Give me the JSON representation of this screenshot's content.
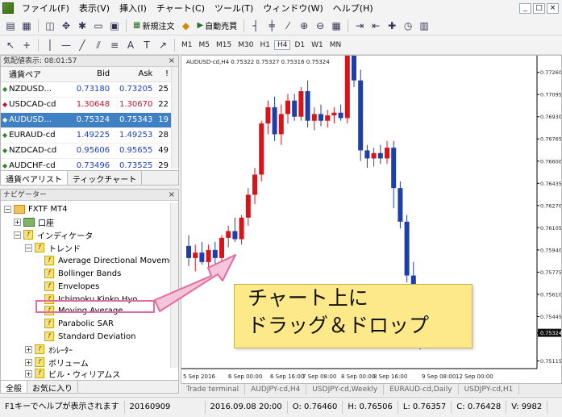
{
  "menubar": {
    "items": [
      "ファイル(F)",
      "表示(V)",
      "挿入(I)",
      "チャート(C)",
      "ツール(T)",
      "ウィンドウ(W)",
      "ヘルプ(H)"
    ],
    "window_buttons": [
      "_",
      "□",
      "×"
    ]
  },
  "toolbar": {
    "new_order_label": "新規注文",
    "auto_trade_label": "自動売買",
    "timeframes": [
      "M1",
      "M5",
      "M15",
      "M30",
      "H1",
      "H4",
      "D1",
      "W1",
      "MN"
    ],
    "active_timeframe": "H4"
  },
  "market_watch": {
    "title": "気配値表示: 08:01:57",
    "col_symbol": "通貨ペア",
    "col_bid": "Bid",
    "col_ask": "Ask",
    "col_extra": "!",
    "rows": [
      {
        "symbol": "NZDUSD...",
        "bid": "0.73180",
        "ask": "0.73205",
        "spread": "25",
        "dir": "up"
      },
      {
        "symbol": "USDCAD-cd",
        "bid": "1.30648",
        "ask": "1.30670",
        "spread": "22",
        "dir": "down"
      },
      {
        "symbol": "AUDUSD...",
        "bid": "0.75324",
        "ask": "0.75343",
        "spread": "19",
        "dir": "up"
      },
      {
        "symbol": "EURAUD-cd",
        "bid": "1.49225",
        "ask": "1.49253",
        "spread": "28",
        "dir": "up"
      },
      {
        "symbol": "NZDCAD-cd",
        "bid": "0.95606",
        "ask": "0.95655",
        "spread": "49",
        "dir": "up"
      },
      {
        "symbol": "AUDCHF-cd",
        "bid": "0.73496",
        "ask": "0.73525",
        "spread": "29",
        "dir": "up"
      }
    ],
    "tabs": [
      "通貨ペアリスト",
      "ティックチャート"
    ]
  },
  "navigator": {
    "title": "ナビゲーター",
    "root": "FXTF MT4",
    "accounts": "口座",
    "indicators": "インディケータ",
    "trend": "トレンド",
    "trend_items": [
      "Average Directional Moveme",
      "Bollinger Bands",
      "Envelopes",
      "Ichimoku Kinko Hyo",
      "Moving Average",
      "Parabolic SAR",
      "Standard Deviation"
    ],
    "oscillators": "ｵｼﾚｰﾀｰ",
    "volumes": "ボリューム",
    "bill_williams": "ビル・ウィリアムス",
    "tabs": [
      "全般",
      "お気に入り"
    ]
  },
  "chart": {
    "header": "AUDUSD-cd,H4  0.75322 0.75327 0.75316 0.75324",
    "ticks": [
      "0.77260",
      "0.77095",
      "0.76930",
      "0.76765",
      "0.76600",
      "0.76435",
      "0.76270",
      "0.76105",
      "0.75940",
      "0.75775",
      "0.75610",
      "0.75445",
      "0.75324",
      "0.75115"
    ],
    "price_tag": "0.75324",
    "x_labels": [
      "5 Sep 2016",
      "6 Sep 00:00",
      "6 Sep 16:00",
      "7 Sep 08:00",
      "8 Sep 00:00",
      "8 Sep 16:00",
      "9 Sep 08:00",
      "12 Sep 00:00"
    ]
  },
  "chart_data": {
    "type": "candlestick",
    "title": "AUDUSD-cd,H4",
    "ylim": [
      0.7507,
      0.773
    ],
    "colors": {
      "up": "#d8141b",
      "down": "#1f3fa8"
    },
    "candles": [
      {
        "o": 0.7597,
        "h": 0.7605,
        "l": 0.7582,
        "c": 0.7588
      },
      {
        "o": 0.7588,
        "h": 0.7598,
        "l": 0.7578,
        "c": 0.7592
      },
      {
        "o": 0.7592,
        "h": 0.76,
        "l": 0.7583,
        "c": 0.7585
      },
      {
        "o": 0.7585,
        "h": 0.7598,
        "l": 0.758,
        "c": 0.7594
      },
      {
        "o": 0.7594,
        "h": 0.76,
        "l": 0.7583,
        "c": 0.7588
      },
      {
        "o": 0.7588,
        "h": 0.7605,
        "l": 0.7585,
        "c": 0.7603
      },
      {
        "o": 0.7603,
        "h": 0.7612,
        "l": 0.7596,
        "c": 0.7608
      },
      {
        "o": 0.7608,
        "h": 0.7618,
        "l": 0.76,
        "c": 0.7602
      },
      {
        "o": 0.7602,
        "h": 0.762,
        "l": 0.7598,
        "c": 0.7618
      },
      {
        "o": 0.7618,
        "h": 0.764,
        "l": 0.7612,
        "c": 0.7635
      },
      {
        "o": 0.7635,
        "h": 0.7655,
        "l": 0.7628,
        "c": 0.765
      },
      {
        "o": 0.765,
        "h": 0.769,
        "l": 0.7645,
        "c": 0.7688
      },
      {
        "o": 0.7688,
        "h": 0.7705,
        "l": 0.768,
        "c": 0.77
      },
      {
        "o": 0.77,
        "h": 0.7708,
        "l": 0.7675,
        "c": 0.768
      },
      {
        "o": 0.768,
        "h": 0.7702,
        "l": 0.7672,
        "c": 0.7695
      },
      {
        "o": 0.7695,
        "h": 0.771,
        "l": 0.7688,
        "c": 0.7705
      },
      {
        "o": 0.7705,
        "h": 0.771,
        "l": 0.769,
        "c": 0.7693
      },
      {
        "o": 0.7693,
        "h": 0.7715,
        "l": 0.769,
        "c": 0.7712
      },
      {
        "o": 0.7712,
        "h": 0.772,
        "l": 0.7685,
        "c": 0.769
      },
      {
        "o": 0.769,
        "h": 0.77,
        "l": 0.7683,
        "c": 0.7695
      },
      {
        "o": 0.7695,
        "h": 0.7702,
        "l": 0.7686,
        "c": 0.769
      },
      {
        "o": 0.769,
        "h": 0.7698,
        "l": 0.7685,
        "c": 0.7694
      },
      {
        "o": 0.7694,
        "h": 0.77,
        "l": 0.7688,
        "c": 0.7696
      },
      {
        "o": 0.7696,
        "h": 0.7702,
        "l": 0.769,
        "c": 0.7692
      },
      {
        "o": 0.7692,
        "h": 0.7745,
        "l": 0.7688,
        "c": 0.774
      },
      {
        "o": 0.774,
        "h": 0.7752,
        "l": 0.7715,
        "c": 0.772
      },
      {
        "o": 0.772,
        "h": 0.7728,
        "l": 0.766,
        "c": 0.7668
      },
      {
        "o": 0.7668,
        "h": 0.7672,
        "l": 0.7655,
        "c": 0.7662
      },
      {
        "o": 0.7662,
        "h": 0.767,
        "l": 0.7656,
        "c": 0.7666
      },
      {
        "o": 0.7666,
        "h": 0.7672,
        "l": 0.7658,
        "c": 0.7662
      },
      {
        "o": 0.7662,
        "h": 0.7675,
        "l": 0.7658,
        "c": 0.767
      },
      {
        "o": 0.767,
        "h": 0.7675,
        "l": 0.7625,
        "c": 0.764
      },
      {
        "o": 0.764,
        "h": 0.7645,
        "l": 0.761,
        "c": 0.7615
      },
      {
        "o": 0.7615,
        "h": 0.762,
        "l": 0.757,
        "c": 0.7575
      },
      {
        "o": 0.7575,
        "h": 0.7585,
        "l": 0.754,
        "c": 0.7548
      },
      {
        "o": 0.7548,
        "h": 0.7555,
        "l": 0.752,
        "c": 0.753
      }
    ]
  },
  "callout": {
    "line1": "チャート上に",
    "line2": "ドラッグ＆ドロップ"
  },
  "terminal_tabs": [
    "Trade terminal",
    "AUDJPY-cd,H4",
    "USDJPY-cd,Weekly",
    "EURAUD-cd,Daily",
    "USDJPY-cd,H1"
  ],
  "statusbar": {
    "help": "F1キーでヘルプが表示されます",
    "profile": "20160909",
    "datetime": "2016.09.08 20:00",
    "open": "O: 0.76460",
    "high": "H: 0.76506",
    "low": "L: 0.76357",
    "close": "C: 0.76428",
    "volume": "V: 9982"
  }
}
